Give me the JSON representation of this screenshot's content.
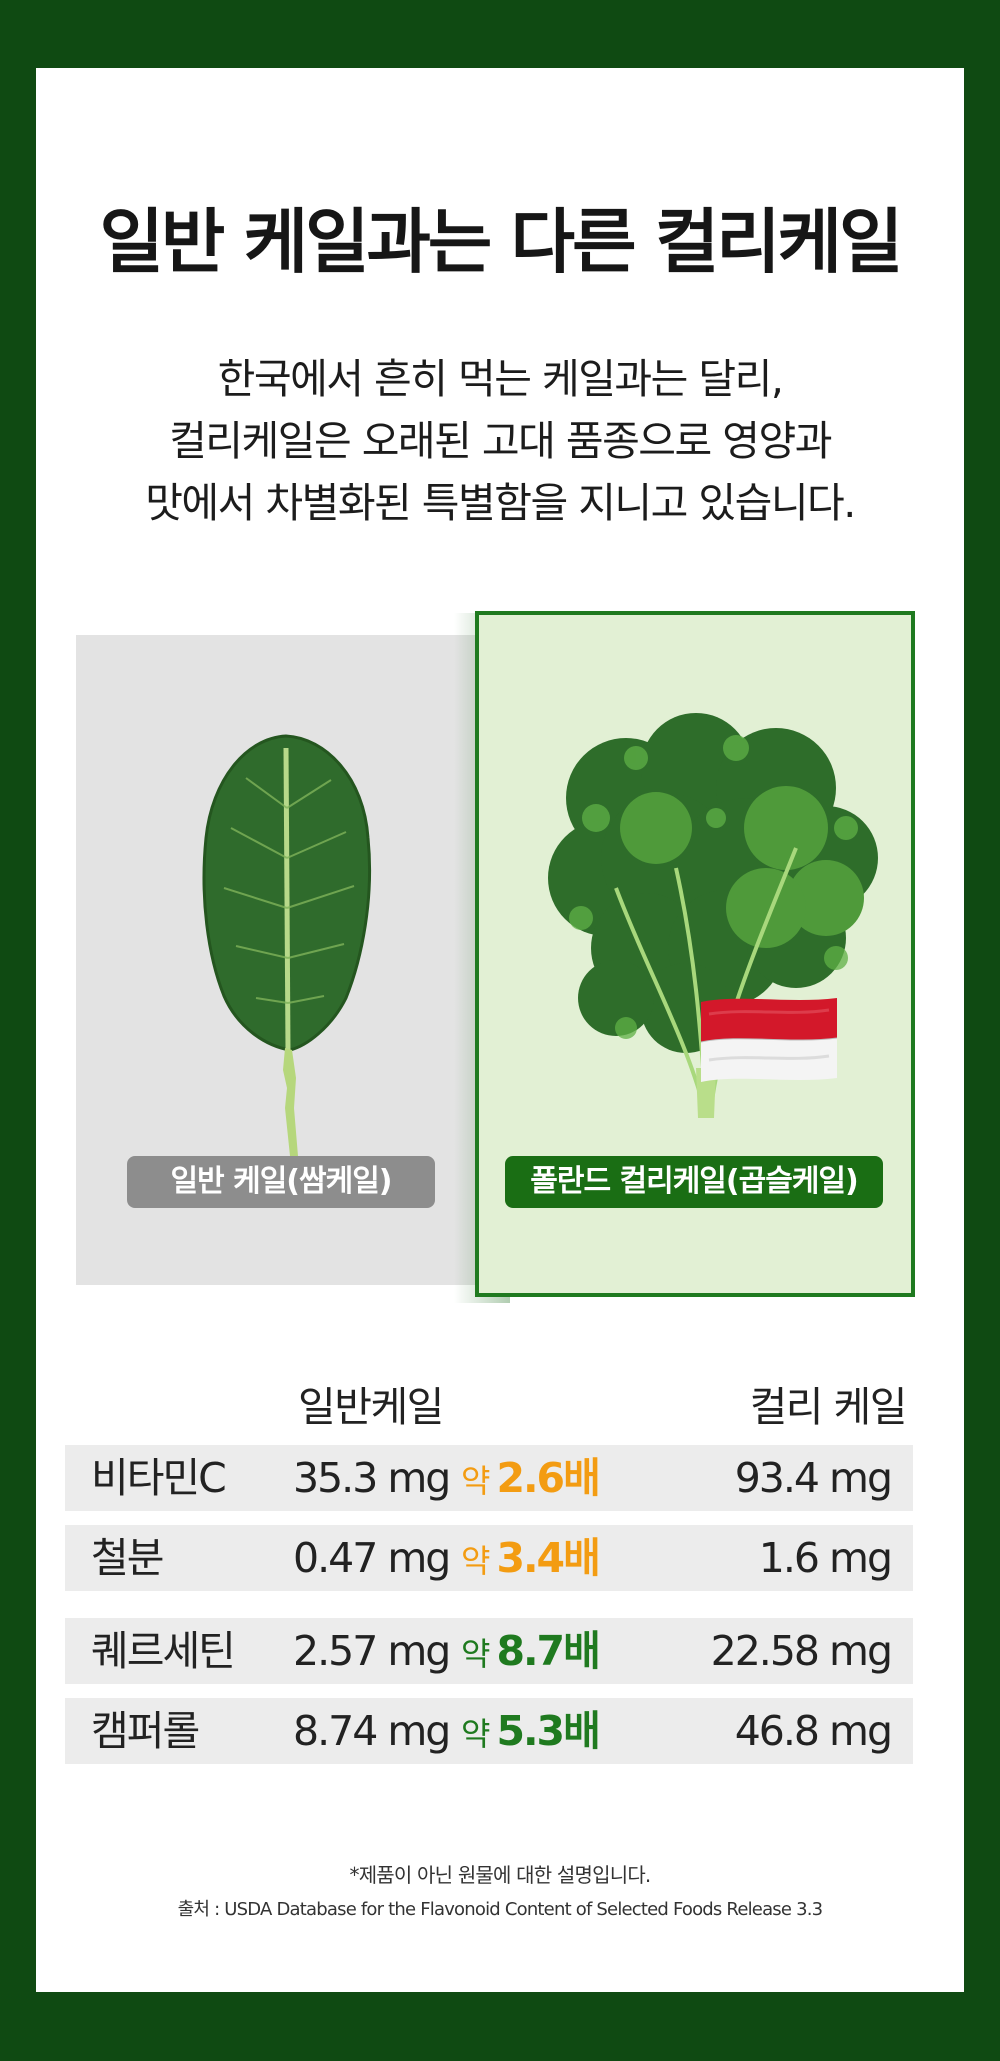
{
  "header": {
    "title": "일반 케일과는 다른 컬리케일",
    "description_lines": [
      "한국에서 흔히 먹는 케일과는 달리,",
      "컬리케일은 오래된 고대 품종으로 영양과",
      "맛에서 차별화된 특별함을 지니고 있습니다."
    ]
  },
  "comparison": {
    "left_label": "일반 케일(쌈케일)",
    "right_label": "폴란드 컬리케일(곱슬케일)",
    "left_icon": "collard-leaf-image",
    "right_icon": "curly-kale-image",
    "flag_icon": "poland-flag-icon"
  },
  "table": {
    "header_normal": "일반케일",
    "header_curly": "컬리 케일",
    "ratio_prefix": "약",
    "rows": [
      {
        "name": "비타민C",
        "normal": "35.3 mg",
        "ratio": "2.6배",
        "curly": "93.4 mg"
      },
      {
        "name": "철분",
        "normal": "0.47 mg",
        "ratio": "3.4배",
        "curly": "1.6 mg"
      },
      {
        "name": "퀘르세틴",
        "normal": "2.57 mg",
        "ratio": "8.7배",
        "curly": "22.58 mg"
      },
      {
        "name": "캠퍼롤",
        "normal": "8.74 mg",
        "ratio": "5.3배",
        "curly": "46.8 mg"
      }
    ]
  },
  "footer": {
    "note": "*제품이 아닌 원물에 대한 설명입니다.",
    "source": "출처 : USDA Database for the Flavonoid Content of Selected Foods Release 3.3"
  },
  "colors": {
    "frame": "#0f4a12",
    "accent_green": "#1f7a1f",
    "accent_orange": "#f39c12",
    "panel_green": "#e2f0d4",
    "panel_gray": "#e3e3e3"
  }
}
